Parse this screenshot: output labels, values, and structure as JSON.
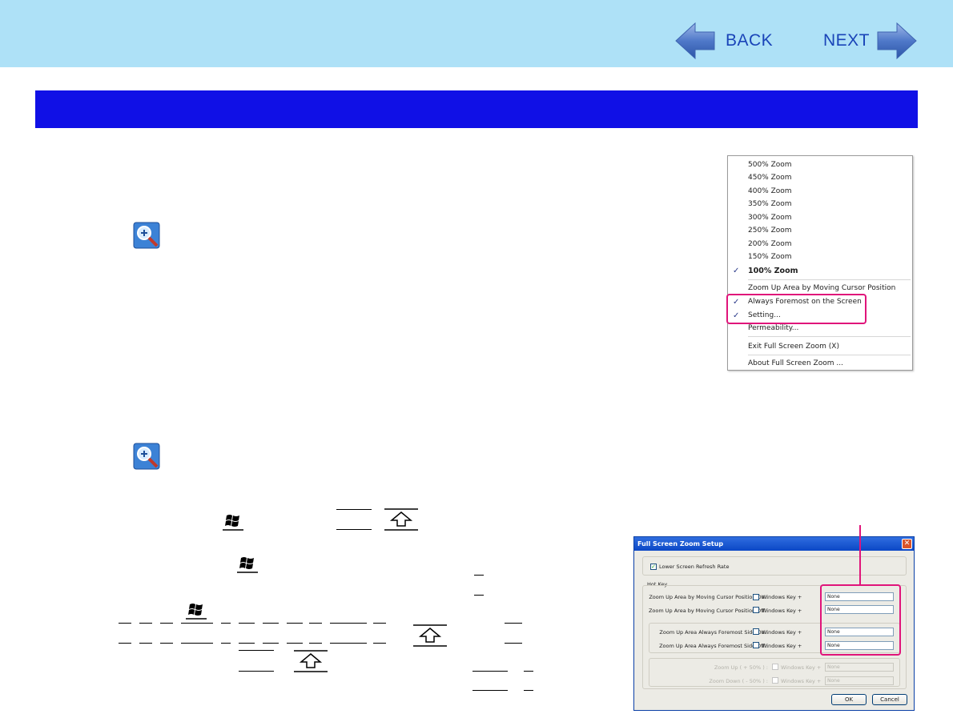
{
  "nav": {
    "back_label": "BACK",
    "next_label": "NEXT"
  },
  "context_menu": {
    "items": [
      {
        "label": "500% Zoom",
        "checked": false,
        "bold": false
      },
      {
        "label": "450% Zoom",
        "checked": false,
        "bold": false
      },
      {
        "label": "400% Zoom",
        "checked": false,
        "bold": false
      },
      {
        "label": "350% Zoom",
        "checked": false,
        "bold": false
      },
      {
        "label": "300% Zoom",
        "checked": false,
        "bold": false
      },
      {
        "label": "250% Zoom",
        "checked": false,
        "bold": false
      },
      {
        "label": "200% Zoom",
        "checked": false,
        "bold": false
      },
      {
        "label": "150% Zoom",
        "checked": false,
        "bold": false
      },
      {
        "label": "100% Zoom",
        "checked": true,
        "bold": true
      },
      {
        "label": "Zoom Up Area by Moving Cursor Position",
        "checked": false,
        "bold": false
      },
      {
        "label": "Always Foremost on the Screen",
        "checked": true,
        "bold": false
      },
      {
        "label": "Setting...",
        "checked": true,
        "bold": false
      },
      {
        "label": "Permeability...",
        "checked": false,
        "bold": false
      },
      {
        "label": "Exit Full Screen Zoom (X)",
        "checked": false,
        "bold": false
      },
      {
        "label": "About Full Screen Zoom ...",
        "checked": false,
        "bold": false
      }
    ],
    "check_glyph": "✓"
  },
  "dialog": {
    "title": "Full Screen Zoom Setup",
    "close_glyph": "✕",
    "lower_refresh_label": "Lower Screen Refresh Rate",
    "lower_refresh_checked": true,
    "hotkey_group_label": "Hot Key",
    "windows_key_label": "Windows Key +",
    "rows": [
      {
        "label": "Zoom Up Area by Moving Cursor Position On :",
        "value": "None",
        "enabled": true
      },
      {
        "label": "Zoom Up Area by Moving Cursor Position Off :",
        "value": "None",
        "enabled": true
      },
      {
        "label": "Zoom Up Area Always Foremost Side On :",
        "value": "None",
        "enabled": true
      },
      {
        "label": "Zoom Up Area Always Foremost Side Off :",
        "value": "None",
        "enabled": true
      },
      {
        "label": "Zoom Up ( + 50% ) :",
        "value": "None",
        "enabled": false
      },
      {
        "label": "Zoom Down ( - 50% ) :",
        "value": "None",
        "enabled": false
      }
    ],
    "ok_label": "OK",
    "cancel_label": "Cancel"
  },
  "colors": {
    "top_bar": "#aee1f7",
    "section_band": "#1010e6",
    "highlight": "#e0147a",
    "nav_text": "#1a44b8"
  },
  "icons": [
    "back-arrow-icon",
    "next-arrow-icon",
    "full-screen-zoom-icon",
    "windows-key-icon",
    "shift-key-icon",
    "checkmark-icon",
    "close-icon"
  ]
}
